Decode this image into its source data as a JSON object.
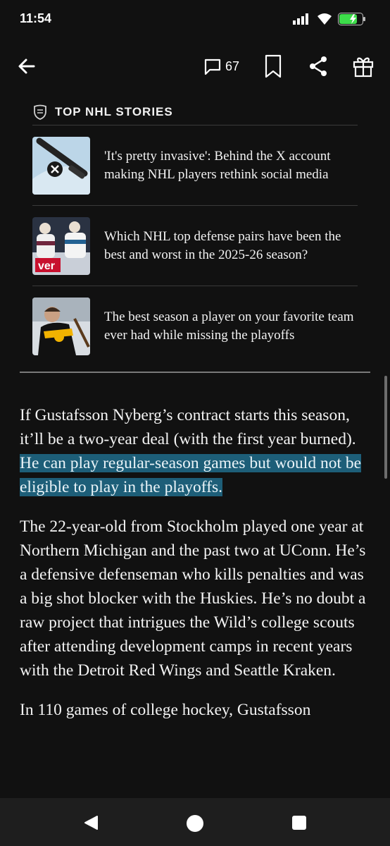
{
  "status": {
    "time": "11:54",
    "icons": [
      "signal-icon",
      "wifi-icon",
      "battery-charging-icon"
    ],
    "battery_color": "#3ddc4a"
  },
  "toolbar": {
    "comment_count": "67",
    "icons": [
      "back-arrow-icon",
      "comment-icon",
      "bookmark-icon",
      "share-icon",
      "gift-icon"
    ]
  },
  "top_stories": {
    "title": "TOP NHL STORIES",
    "icon": "nhl-logo-icon",
    "items": [
      {
        "headline": "'It's pretty invasive': Behind the X account making NHL players rethink social media"
      },
      {
        "headline": "Which NHL top defense pairs have been the best and worst in the 2025-26 season?"
      },
      {
        "headline": "The best season a player on your favorite team ever had while missing the playoffs"
      }
    ]
  },
  "article": {
    "p1_plain": "If Gustafsson Nyberg’s contract starts this season, it’ll be a two-year deal (with the first year burned). ",
    "p1_highlight": "He can play regular-season games but would not be eligible to play in the playoffs.",
    "p2": "The 22-year-old from Stockholm played one year at Northern Michigan and the past two at UConn. He’s a defensive defenseman who kills penalties and was a big shot blocker with the Huskies. He’s no doubt a raw project that intrigues the Wild’s college scouts after attending development camps in recent years with the Detroit Red Wings and Seattle Kraken.",
    "p3": "In 110 games of college hockey, Gustafsson",
    "highlight_color": "#1d5e78"
  },
  "nav_bar": {
    "icons": [
      "nav-back-icon",
      "nav-home-icon",
      "nav-recents-icon"
    ]
  }
}
